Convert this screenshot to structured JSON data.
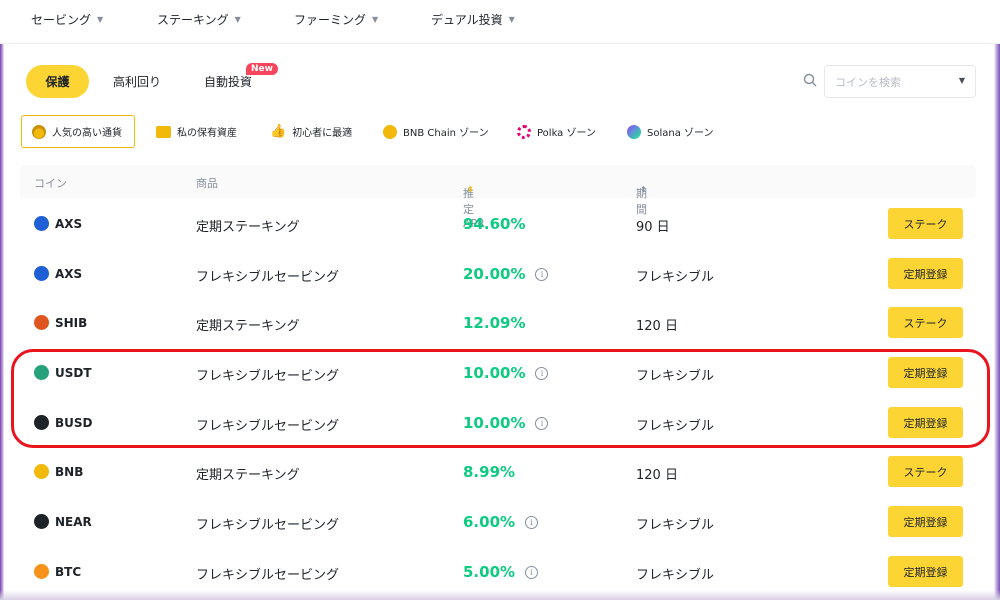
{
  "topnav": [
    {
      "label": "セービング"
    },
    {
      "label": "ステーキング"
    },
    {
      "label": "ファーミング"
    },
    {
      "label": "デュアル投資"
    }
  ],
  "tabs": [
    {
      "label": "保護",
      "active": true
    },
    {
      "label": "高利回り",
      "active": false
    },
    {
      "label": "自動投資",
      "active": false,
      "badge": "New"
    }
  ],
  "search": {
    "placeholder": "コインを検索"
  },
  "filters": [
    {
      "label": "人気の高い通貨",
      "icon": "flame-coin-icon",
      "active": true
    },
    {
      "label": "私の保有資産",
      "icon": "wallet-icon"
    },
    {
      "label": "初心者に最適",
      "icon": "thumbs-up-icon"
    },
    {
      "label": "BNB Chain ゾーン",
      "icon": "bnb-icon"
    },
    {
      "label": "Polka ゾーン",
      "icon": "polkadot-icon"
    },
    {
      "label": "Solana ゾーン",
      "icon": "solana-icon"
    }
  ],
  "table": {
    "headers": {
      "coin": "コイン",
      "product": "商品",
      "apr": "推定APR",
      "period": "期間"
    },
    "rows": [
      {
        "coin": "AXS",
        "product": "定期ステーキング",
        "apr": "94.60%",
        "period": "90 日",
        "button": "ステーク",
        "info": false,
        "color": "#1f5fd6"
      },
      {
        "coin": "AXS",
        "product": "フレキシブルセービング",
        "apr": "20.00%",
        "period": "フレキシブル",
        "button": "定期登録",
        "info": true,
        "color": "#1f5fd6"
      },
      {
        "coin": "SHIB",
        "product": "定期ステーキング",
        "apr": "12.09%",
        "period": "120 日",
        "button": "ステーク",
        "info": false,
        "color": "#e0551f"
      },
      {
        "coin": "USDT",
        "product": "フレキシブルセービング",
        "apr": "10.00%",
        "period": "フレキシブル",
        "button": "定期登録",
        "info": true,
        "color": "#26a17b"
      },
      {
        "coin": "BUSD",
        "product": "フレキシブルセービング",
        "apr": "10.00%",
        "period": "フレキシブル",
        "button": "定期登録",
        "info": true,
        "color": "#1e2329"
      },
      {
        "coin": "BNB",
        "product": "定期ステーキング",
        "apr": "8.99%",
        "period": "120 日",
        "button": "ステーク",
        "info": false,
        "color": "#f0b90b"
      },
      {
        "coin": "NEAR",
        "product": "フレキシブルセービング",
        "apr": "6.00%",
        "period": "フレキシブル",
        "button": "定期登録",
        "info": true,
        "color": "#1e2329"
      },
      {
        "coin": "BTC",
        "product": "フレキシブルセービング",
        "apr": "5.00%",
        "period": "フレキシブル",
        "button": "定期登録",
        "info": true,
        "color": "#f7931a"
      }
    ]
  },
  "colors": {
    "accent": "#fcd535",
    "apr_green": "#0ecb81",
    "highlight_red": "#e8141e"
  }
}
